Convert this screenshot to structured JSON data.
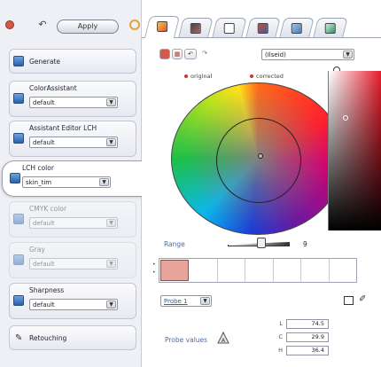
{
  "toolbar": {
    "apply_label": "Apply",
    "icons": [
      "toggle-dot-icon",
      "undo-icon",
      "gear-icon"
    ]
  },
  "panel": {
    "items": [
      {
        "label": "Generate",
        "value": null,
        "state": "normal",
        "icon": "generate-icon"
      },
      {
        "label": "ColorAssistant",
        "value": "default",
        "state": "normal",
        "icon": "color-assistant-icon"
      },
      {
        "label": "Assistant Editor LCH",
        "value": "default",
        "state": "normal",
        "icon": "lch-editor-icon"
      },
      {
        "label": "LCH color",
        "value": "skin_tim",
        "state": "selected",
        "icon": "lch-color-icon"
      },
      {
        "label": "CMYK color",
        "value": "default",
        "state": "disabled",
        "icon": "cmyk-icon"
      },
      {
        "label": "Gray",
        "value": "default",
        "state": "disabled",
        "icon": "gray-icon"
      },
      {
        "label": "Sharpness",
        "value": "default",
        "state": "normal",
        "icon": "sharpness-icon"
      },
      {
        "label": "Retouching",
        "value": null,
        "state": "normal",
        "icon": "retouching-icon"
      }
    ]
  },
  "tabs": [
    {
      "icon": "color-tab-icon",
      "active": true
    },
    {
      "icon": "image-tab-icon",
      "active": false
    },
    {
      "icon": "frame-tab-icon",
      "active": false
    },
    {
      "icon": "photo-tab-icon",
      "active": false
    },
    {
      "icon": "layers-tab-icon",
      "active": false
    },
    {
      "icon": "settings-tab-icon",
      "active": false
    }
  ],
  "editor": {
    "mode_value": "(Ilseid)",
    "legend_original": "original",
    "legend_corrected": "corrected",
    "range_label": "Range",
    "range_value": "9",
    "range_level": 0.55,
    "probe_select": "Probe 1",
    "probe_values_label": "Probe values",
    "lch": [
      {
        "key": "L",
        "value": "74.5"
      },
      {
        "key": "C",
        "value": "29.9"
      },
      {
        "key": "H",
        "value": "36.4"
      }
    ],
    "swatch_color": "#e8a49a",
    "swatch_count": 7,
    "accent_label_color": "#4a6fa8"
  }
}
